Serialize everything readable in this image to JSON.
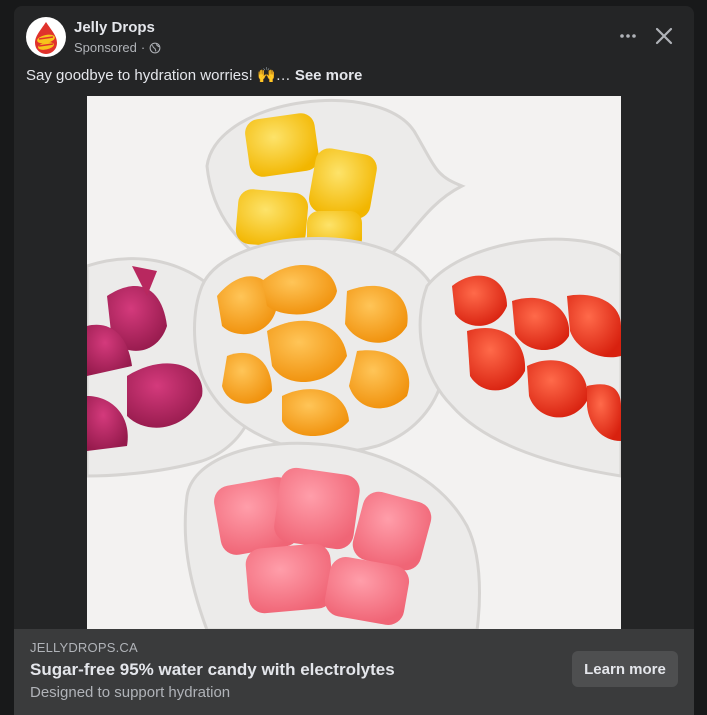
{
  "post": {
    "page_name": "Jelly Drops",
    "sponsored_label": "Sponsored",
    "separator": "·",
    "avatar_logo_text": "Jelly Drops",
    "caption_text": "Say goodbye to hydration worries! 🙌…",
    "see_more": "See more"
  },
  "link_preview": {
    "domain": "JELLYDROPS.CA",
    "headline": "Sugar-free 95% water candy with electrolytes",
    "description": "Designed to support hydration",
    "cta_label": "Learn more"
  },
  "icons": {
    "globe": "globe-icon",
    "more": "more-options-icon",
    "close": "close-icon"
  },
  "colors": {
    "background": "#18191a",
    "card": "#242526",
    "footer": "#3a3b3c",
    "button": "#4e4f50",
    "text_primary": "#e4e6eb",
    "text_secondary": "#b0b3b8",
    "brand_red": "#e0322c",
    "brand_yellow": "#f7c41b"
  }
}
